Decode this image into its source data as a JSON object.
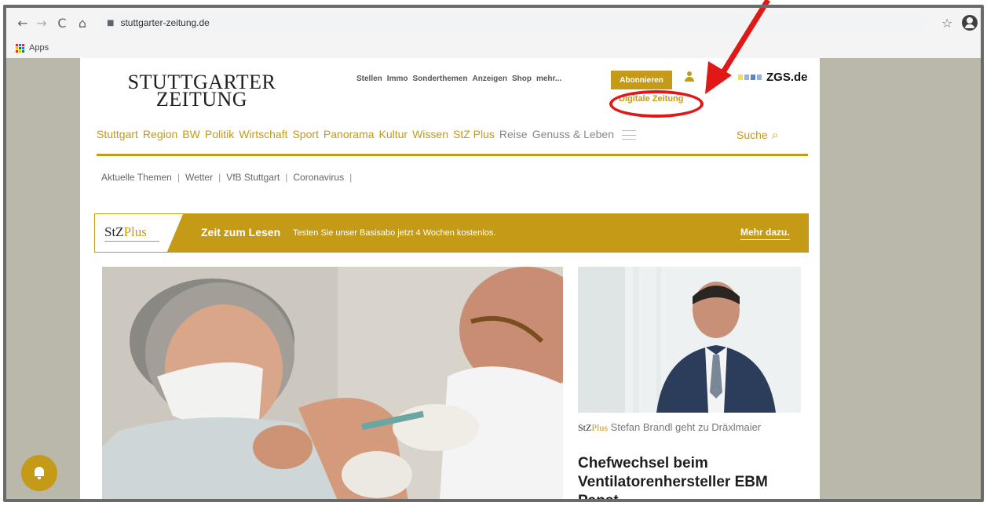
{
  "browser": {
    "url": "stuttgarter-zeitung.de",
    "bookmarks_apps": "Apps",
    "nav_back": "←",
    "nav_forward": "→",
    "nav_reload": "C",
    "nav_home": "⌂",
    "star": "☆"
  },
  "site": {
    "logo_line1": "STUTTGARTER",
    "logo_line2": "ZEITUNG",
    "top_nav": [
      "Stellen",
      "Immo",
      "Sonderthemen",
      "Anzeigen",
      "Shop",
      "mehr..."
    ],
    "subscribe_label": "Abonnieren",
    "zgs_label": "ZGS.de",
    "digital_edition_label": "Digitale Zeitung",
    "main_nav": [
      "Stuttgart",
      "Region",
      "BW",
      "Politik",
      "Wirtschaft",
      "Sport",
      "Panorama",
      "Kultur",
      "Wissen",
      "StZ Plus",
      "Reise",
      "Genuss & Leben"
    ],
    "search_label": "Suche",
    "topics": [
      "Aktuelle Themen",
      "Wetter",
      "VfB Stuttgart",
      "Coronavirus"
    ],
    "topic_separator": "|"
  },
  "promo": {
    "brand_stz": "StZ",
    "brand_plus": "Plus",
    "title": "Zeit zum Lesen",
    "text": "Testen Sie unser Basisabo jetzt 4 Wochen kostenlos.",
    "more_label": "Mehr dazu."
  },
  "side_article": {
    "brand_stz": "StZ",
    "brand_plus": "Plus",
    "kicker": "Stefan Brandl geht zu Dräxlmaier",
    "headline": "Chefwechsel beim Ventilatorenhersteller EBM Papst"
  },
  "colors": {
    "accent": "#c49a16",
    "annotation": "#e01818",
    "backdrop": "#b9b8ab"
  },
  "icons": {
    "profile": "account-circle-icon",
    "user": "user-icon",
    "search": "search-icon",
    "menu": "hamburger-icon",
    "notifications": "bell-icon"
  }
}
